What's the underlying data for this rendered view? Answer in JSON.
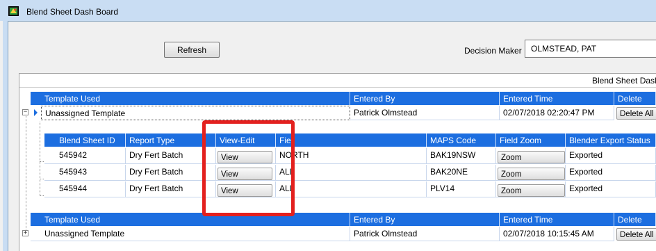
{
  "window": {
    "title": "Blend Sheet Dash Board"
  },
  "toolbar": {
    "refresh_label": "Refresh",
    "decision_maker_label": "Decision Maker",
    "decision_maker_value": "OLMSTEAD, PAT"
  },
  "grid": {
    "caption": "Blend Sheet Dasl",
    "template_headers": [
      "Template Used",
      "Entered By",
      "Entered Time",
      "Delete"
    ],
    "templates": [
      {
        "template": "Unassigned Template",
        "entered_by": "Patrick Olmstead",
        "entered_time": "02/07/2018 02:20:47 PM",
        "delete_label": "Delete All",
        "expanded": true
      },
      {
        "template": "Unassigned Template",
        "entered_by": "Patrick Olmstead",
        "entered_time": "02/07/2018 10:15:45 AM",
        "delete_label": "Delete All",
        "expanded": false
      }
    ],
    "sheet_headers": [
      "Blend Sheet ID",
      "Report Type",
      "View-Edit",
      "Fiel",
      "MAPS Code",
      "Field Zoom",
      "Blender Export Status"
    ],
    "sheets": [
      {
        "id": "545942",
        "report_type": "Dry Fert Batch",
        "view_label": "View",
        "field": "NORTH",
        "maps_code": "BAK19NSW",
        "zoom_label": "Zoom",
        "status": "Exported"
      },
      {
        "id": "545943",
        "report_type": "Dry Fert Batch",
        "view_label": "View",
        "field": "ALL",
        "maps_code": "BAK20NE",
        "zoom_label": "Zoom",
        "status": "Exported"
      },
      {
        "id": "545944",
        "report_type": "Dry Fert Batch",
        "view_label": "View",
        "field": "ALL",
        "maps_code": "PLV14",
        "zoom_label": "Zoom",
        "status": "Exported"
      }
    ]
  },
  "colors": {
    "header_blue": "#1c6ee0",
    "highlight_red": "#e3201e",
    "titlebar": "#c9ddf3"
  },
  "icons": {
    "app": "app-icon",
    "band": "band-selector-icon",
    "expand": "expand-icon",
    "collapse": "collapse-icon",
    "current_row": "current-row-indicator-icon"
  }
}
